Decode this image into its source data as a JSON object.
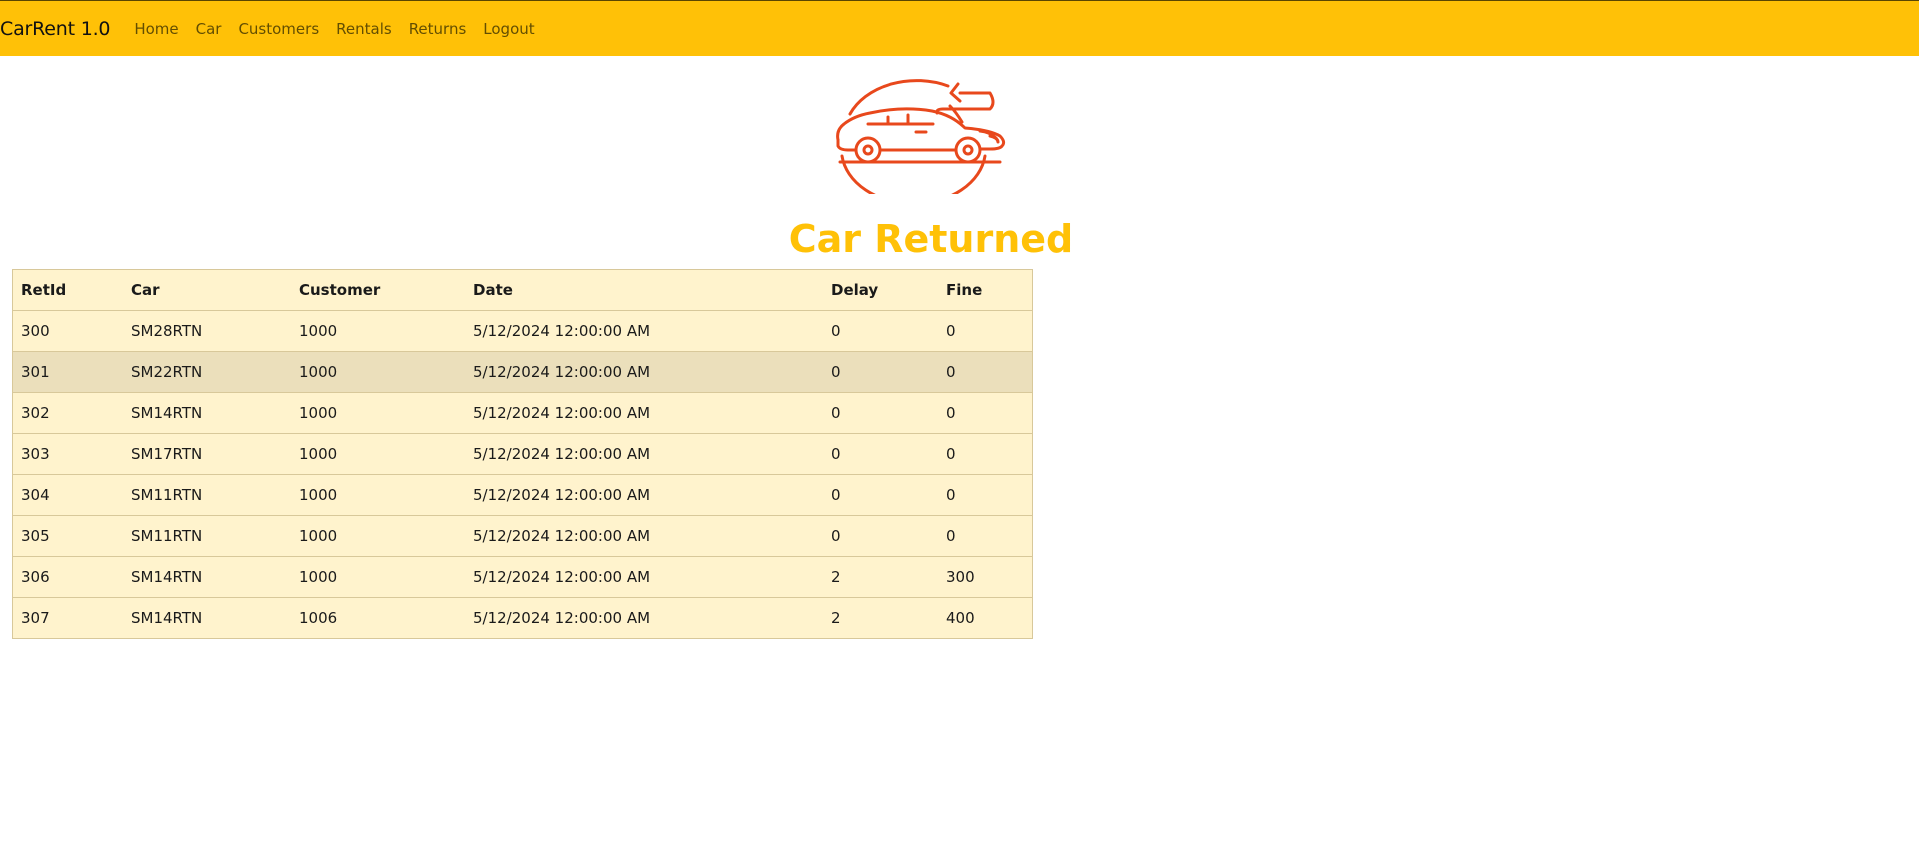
{
  "navbar": {
    "brand": "CarRent 1.0",
    "links": [
      "Home",
      "Car",
      "Customers",
      "Rentals",
      "Returns",
      "Logout"
    ]
  },
  "logo": {
    "icon": "car-return-icon",
    "color": "#e8481c"
  },
  "page": {
    "title": "Car Returned"
  },
  "table": {
    "headers": [
      "RetId",
      "Car",
      "Customer",
      "Date",
      "Delay",
      "Fine"
    ],
    "rows": [
      [
        "300",
        "SM28RTN",
        "1000",
        "5/12/2024 12:00:00 AM",
        "0",
        "0"
      ],
      [
        "301",
        "SM22RTN",
        "1000",
        "5/12/2024 12:00:00 AM",
        "0",
        "0"
      ],
      [
        "302",
        "SM14RTN",
        "1000",
        "5/12/2024 12:00:00 AM",
        "0",
        "0"
      ],
      [
        "303",
        "SM17RTN",
        "1000",
        "5/12/2024 12:00:00 AM",
        "0",
        "0"
      ],
      [
        "304",
        "SM11RTN",
        "1000",
        "5/12/2024 12:00:00 AM",
        "0",
        "0"
      ],
      [
        "305",
        "SM11RTN",
        "1000",
        "5/12/2024 12:00:00 AM",
        "0",
        "0"
      ],
      [
        "306",
        "SM14RTN",
        "1000",
        "5/12/2024 12:00:00 AM",
        "2",
        "300"
      ],
      [
        "307",
        "SM14RTN",
        "1006",
        "5/12/2024 12:00:00 AM",
        "2",
        "400"
      ]
    ]
  },
  "colors": {
    "accent": "#ffc107",
    "table_bg": "#fff3cd",
    "row_hover": "#ebdfbb",
    "logo": "#e8481c"
  }
}
